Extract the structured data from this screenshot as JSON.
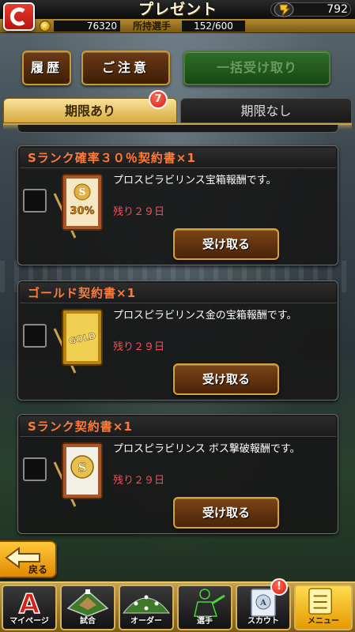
{
  "header": {
    "title": "プレゼント",
    "gems": "792",
    "coins": "76320",
    "owned_label": "所持選手",
    "owned_value": "152/600"
  },
  "actions": {
    "history": "履歴",
    "caution": "ご注意",
    "bulk_receive": "一括受け取り"
  },
  "tabs": [
    {
      "label": "期限あり",
      "badge": "7",
      "active": true
    },
    {
      "label": "期限なし",
      "active": false
    }
  ],
  "items": [
    {
      "title": "Sランク確率３０％契約書×1",
      "description": "プロスピラビリンス宝箱報酬です。",
      "remaining": "残り２９日",
      "button": "受け取る",
      "icon": "contract-30-icon",
      "card_label": "30%"
    },
    {
      "title": "ゴールド契約書×1",
      "description": "プロスピラビリンス金の宝箱報酬です。",
      "remaining": "残り２９日",
      "button": "受け取る",
      "icon": "gold-contract-icon",
      "card_label": "GOLD"
    },
    {
      "title": "Sランク契約書×1",
      "description": "プロスピラビリンス ボス撃破報酬です。",
      "remaining": "残り２９日",
      "button": "受け取る",
      "icon": "s-contract-icon",
      "card_label": "S"
    }
  ],
  "back_label": "戻る",
  "nav": [
    {
      "label": "マイページ",
      "icon": "mypage-icon"
    },
    {
      "label": "試合",
      "icon": "match-icon"
    },
    {
      "label": "オーダー",
      "icon": "order-icon"
    },
    {
      "label": "選手",
      "icon": "player-icon"
    },
    {
      "label": "スカウト",
      "icon": "scout-icon",
      "badge": "!"
    },
    {
      "label": "メニュー",
      "icon": "menu-icon"
    }
  ]
}
